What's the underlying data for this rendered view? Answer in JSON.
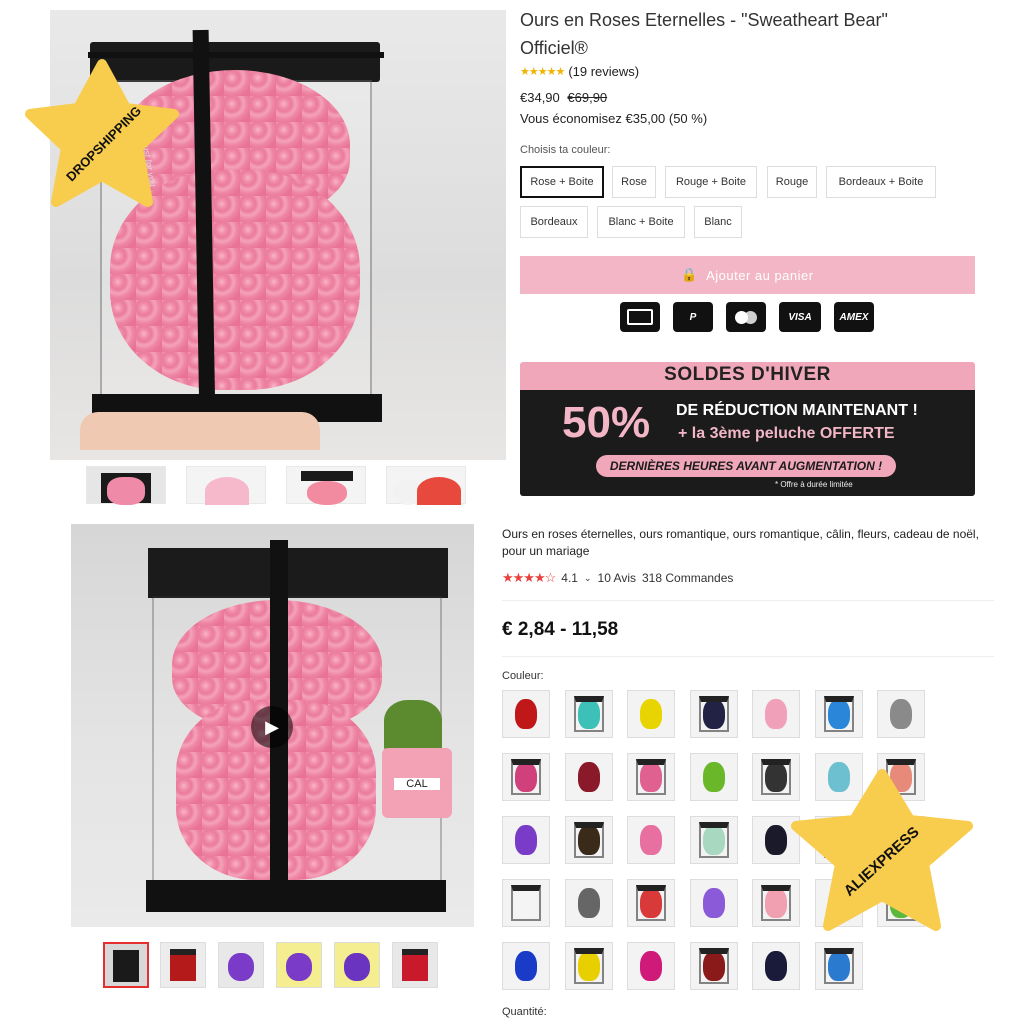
{
  "shop": {
    "title": "Ours en Roses Eternelles - \"Sweatheart Bear\" Officiel®",
    "reviews": "(19 reviews)",
    "price_new": "€34,90",
    "price_old": "€69,90",
    "savings": "Vous économisez €35,00 (50 %)",
    "choose_label": "Choisis ta couleur:",
    "colors": [
      "Rose + Boite",
      "Rose",
      "Rouge + Boite",
      "Rouge",
      "Bordeaux + Boite",
      "Bordeaux",
      "Blanc + Boite",
      "Blanc"
    ],
    "selected_color": "Rose + Boite",
    "add_to_cart": "Ajouter au panier",
    "payment_icons": [
      "card-icon",
      "paypal-icon",
      "mastercard-icon",
      "visa-icon",
      "amex-icon"
    ],
    "payment_labels": {
      "paypal": "P",
      "visa": "VISA",
      "amex": "AMEX"
    },
    "box_ribbon_text": "Just for you",
    "badge": "DROPSHIPPING"
  },
  "banner": {
    "title": "SOLDES D'HIVER",
    "percent": "50%",
    "line1": "DE RÉDUCTION MAINTENANT !",
    "line2": "+ la 3ème peluche OFFERTE",
    "pill": "DERNIÈRES HEURES AVANT AUGMENTATION !",
    "note": "* Offre à durée limitée"
  },
  "ali": {
    "title": "Ours en roses éternelles, ours romantique, ours romantique, câlin, fleurs, cadeau de noël, pour un mariage",
    "rating": "4.1",
    "avis": "10 Avis",
    "orders": "318 Commandes",
    "price": "€ 2,84 - 11,58",
    "color_label": "Couleur:",
    "quantity_label": "Quantité:",
    "badge": "ALIEXPRESS",
    "pot_text": "CAL",
    "swatch_colors": [
      [
        "#c01818",
        "#3cc0b8",
        "#e8d400",
        "#222244",
        "#f0a0b8",
        "#2a86d8",
        "#8a8a8a"
      ],
      [
        "#d0407a",
        "#8a1a2a",
        "#e06090",
        "#6ab82a",
        "#333333",
        "#6cc0d0",
        "#e88a7a"
      ],
      [
        "#7a3cc8",
        "#3a2a1a",
        "#e870a0",
        "#a8d8c0",
        "#1a1a2a",
        "#e0e0e0",
        "#f0f0f0"
      ],
      [
        "#f4f4f4",
        "#666666",
        "#d83a3a",
        "#8a5ad8",
        "#f0a0b0",
        "#e8807a",
        "#5cb83c"
      ],
      [
        "#1a3ac8",
        "#e8d000",
        "#d01a7a",
        "#8a1a1a",
        "#1a1a3a",
        "#2a7ad0"
      ]
    ]
  }
}
